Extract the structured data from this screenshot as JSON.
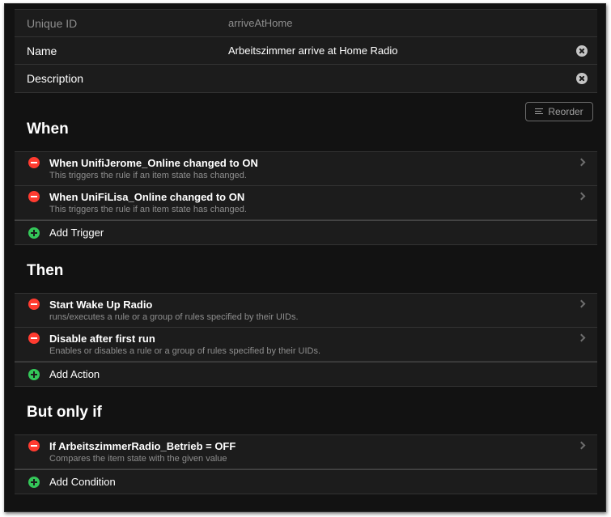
{
  "info": {
    "uid_label": "Unique ID",
    "uid_value": "arriveAtHome",
    "name_label": "Name",
    "name_value": "Arbeitszimmer arrive at Home Radio",
    "description_label": "Description",
    "description_value": ""
  },
  "toolbar": {
    "reorder_label": "Reorder"
  },
  "sections": {
    "when": {
      "title": "When",
      "items": [
        {
          "title": "When UnifiJerome_Online changed to ON",
          "description": "This triggers the rule if an item state has changed."
        },
        {
          "title": "When UniFiLisa_Online changed to ON",
          "description": "This triggers the rule if an item state has changed."
        }
      ],
      "add_label": "Add Trigger"
    },
    "then": {
      "title": "Then",
      "items": [
        {
          "title": "Start Wake Up Radio",
          "description": "runs/executes a rule or a group of rules specified by their UIDs."
        },
        {
          "title": "Disable after first run",
          "description": "Enables or disables a rule or a group of rules specified by their UIDs."
        }
      ],
      "add_label": "Add Action"
    },
    "but_only_if": {
      "title": "But only if",
      "items": [
        {
          "title": "If ArbeitszimmerRadio_Betrieb = OFF",
          "description": "Compares the item state with the given value"
        }
      ],
      "add_label": "Add Condition"
    }
  },
  "colors": {
    "background": "#121212",
    "list_background": "#1c1c1c",
    "remove": "#ff3b30",
    "add": "#34c759"
  }
}
